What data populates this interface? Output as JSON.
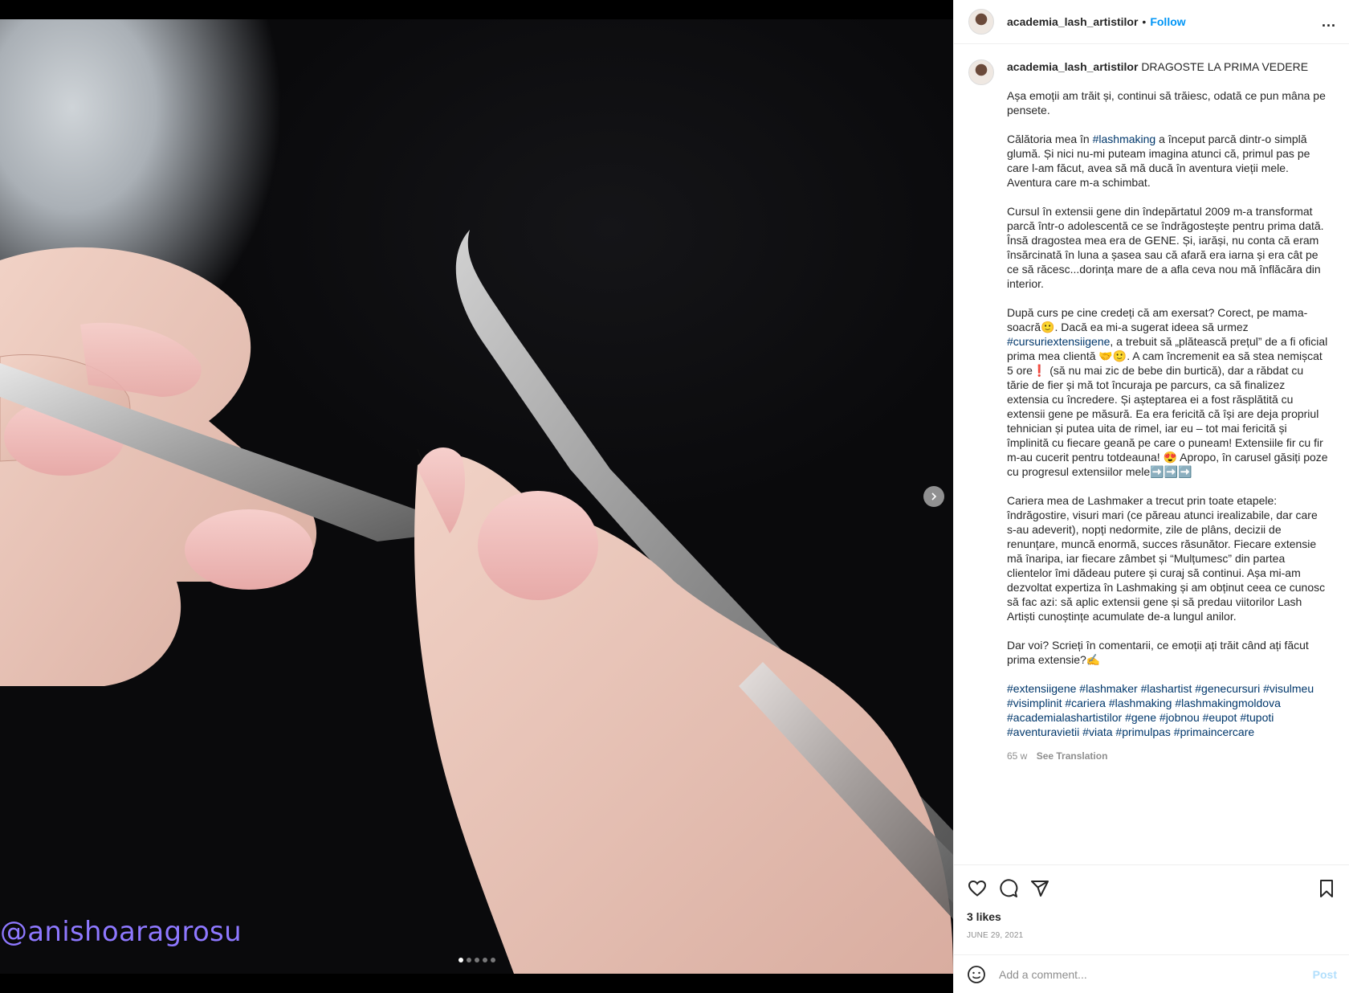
{
  "post": {
    "watermark": "@anishoaragrosu",
    "carousel": {
      "slide_count": 5,
      "current": 1
    }
  },
  "header": {
    "username": "academia_lash_artistilor",
    "separator": "•",
    "follow_label": "Follow",
    "more_label": "..."
  },
  "caption": {
    "username": "academia_lash_artistilor",
    "title": "DRAGOSTE LA PRIMA VEDERE",
    "p1": "Așa emoții am trăit și, continui să trăiesc, odată ce pun mâna pe pensete.",
    "p2_before": "Călătoria mea în ",
    "p2_tag": "#lashmaking",
    "p2_after": " a început parcă dintr-o simplă glumă. Și nici nu-mi puteam imagina atunci că, primul pas pe care l-am făcut, avea să mă ducă în aventura vieții mele. Aventura care m-a schimbat.",
    "p3": "Cursul în extensii gene din îndepărtatul 2009 m-a transformat parcă într-o adolescentă ce se îndrăgostește pentru prima dată. Însă dragostea mea era de GENE. Și, iarăși, nu conta că eram însărcinată în luna a șasea sau că afară era iarna și era cât pe ce să răcesc...dorința mare de a afla ceva nou mă înflăcăra din interior.",
    "p4_before": "După curs pe cine credeți că am exersat? Corect, pe mama-soacră🙂. Dacă ea mi-a sugerat ideea să urmez ",
    "p4_tag": "#cursuriextensiigene",
    "p4_after": ", a trebuit să „plătească prețul” de a fi oficial prima mea clientă 🤝🙂. A cam încremenit ea să stea nemișcat 5 ore❗ (să nu mai zic de bebe din burtică), dar a răbdat cu tărie de fier și mă tot încuraja pe parcurs, ca să finalizez extensia cu încredere. Și așteptarea ei a fost răsplătită cu extensii gene pe măsură. Ea era fericită că își are deja propriul tehnician și putea uita de rimel, iar eu – tot mai fericită și împlinită cu fiecare geană pe care o puneam! Extensiile fir cu fir m-au cucerit pentru totdeauna! 😍 Apropo, în carusel găsiți poze cu progresul extensiilor mele➡️➡️➡️",
    "p5": "Cariera mea de Lashmaker a trecut prin toate etapele: îndrăgostire, visuri mari (ce păreau atunci irealizabile, dar care s-au adeverit), nopți nedormite, zile de plâns, decizii de renunțare, muncă enormă, succes răsunător. Fiecare extensie mă înaripa, iar fiecare zâmbet și “Mulțumesc” din partea clientelor îmi dădeau putere și curaj să continui. Așa mi-am dezvoltat expertiza în Lashmaking și am obținut ceea ce cunosc să fac azi: să aplic extensii gene și să predau viitorilor Lash Artiști cunoștințe acumulate de-a lungul anilor.",
    "p6": "Dar voi? Scrieți în comentarii, ce emoții ați trăit când ați făcut prima extensie?✍️",
    "hashtags": [
      "#extensiigene",
      "#lashmaker",
      "#lashartist",
      "#genecursuri",
      "#visulmeu",
      "#visimplinit",
      "#cariera",
      "#lashmaking",
      "#lashmakingmoldova",
      "#academialashartistilor",
      "#gene",
      "#jobnou",
      "#eupot",
      "#tupoti",
      "#aventuravietii",
      "#viata",
      "#primulpas",
      "#primaincercare"
    ],
    "age": "65 w",
    "see_translation": "See Translation"
  },
  "actions": {
    "likes": "3 likes",
    "date": "JUNE 29, 2021"
  },
  "comment": {
    "placeholder": "Add a comment...",
    "post_label": "Post"
  },
  "colors": {
    "follow": "#0095f6",
    "hashtag": "#00376b",
    "post_disabled": "#b2dffc",
    "watermark": "#8e78ff"
  }
}
